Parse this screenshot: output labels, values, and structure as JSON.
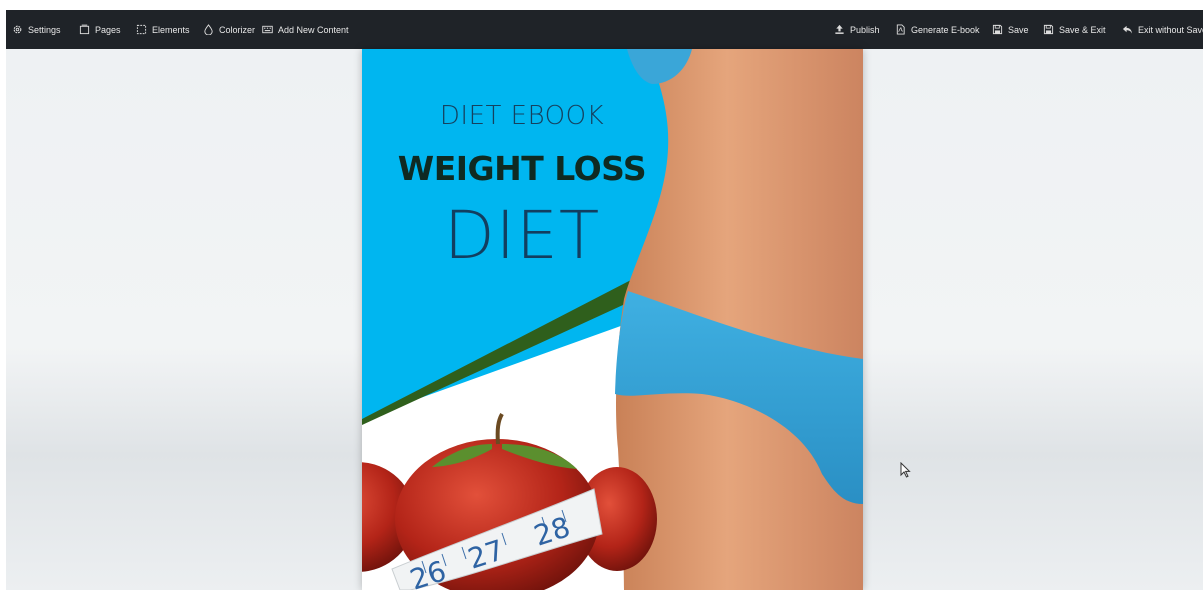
{
  "toolbar": {
    "left": [
      {
        "label": "Settings",
        "icon": "gear-icon"
      },
      {
        "label": "Pages",
        "icon": "pages-icon"
      },
      {
        "label": "Elements",
        "icon": "elements-icon"
      },
      {
        "label": "Colorizer",
        "icon": "droplet-icon"
      },
      {
        "label": "Add New Content",
        "icon": "keyboard-icon"
      }
    ],
    "right": [
      {
        "label": "Publish",
        "icon": "upload-icon"
      },
      {
        "label": "Generate E-book",
        "icon": "pdf-icon"
      },
      {
        "label": "Save",
        "icon": "floppy-icon"
      },
      {
        "label": "Save & Exit",
        "icon": "floppy-icon"
      },
      {
        "label": "Exit without Save",
        "icon": "reply-icon"
      }
    ]
  },
  "cover": {
    "subtitle": "DIET EBOOK",
    "title": "WEIGHT LOSS",
    "main": "DIET",
    "tape_numbers": [
      "26",
      "27",
      "28"
    ],
    "colors": {
      "sky": "#00b6f0",
      "stripe": "#2f5f1c",
      "bikini": "#3aa6d8",
      "skin": "#d9956c",
      "apple": "#b32418"
    }
  }
}
